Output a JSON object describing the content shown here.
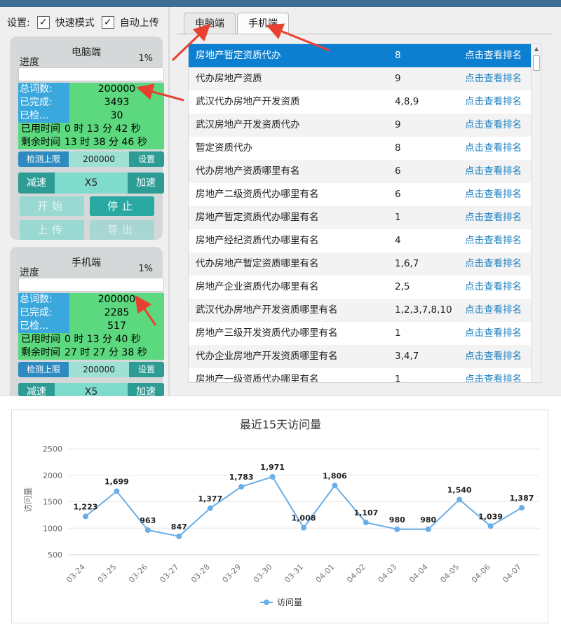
{
  "settings": {
    "label": "设置:",
    "check_mark": "✓",
    "fast_mode": "快速模式",
    "auto_upload": "自动上传"
  },
  "pc_panel": {
    "title": "电脑端",
    "progress_label": "进度",
    "progress_pct": "1%",
    "stats": [
      {
        "label": "总词数:",
        "value": "200000"
      },
      {
        "label": "已完成:",
        "value": "3493"
      },
      {
        "label": "已检...",
        "value": "30"
      }
    ],
    "time_used": {
      "label": "已用时间",
      "value": "0 时 13 分 42 秒"
    },
    "time_left": {
      "label": "剩余时间",
      "value": "13 时 38 分 46 秒"
    },
    "limit": {
      "label": "检测上限",
      "value": "200000",
      "button": "设置"
    },
    "speed": {
      "down": "减速",
      "value": "X5",
      "up": "加速"
    },
    "buttons": {
      "start": "开始",
      "stop": "停止",
      "upload": "上传",
      "export": "导出"
    }
  },
  "mobile_panel": {
    "title": "手机端",
    "progress_label": "进度",
    "progress_pct": "1%",
    "stats": [
      {
        "label": "总词数:",
        "value": "200000"
      },
      {
        "label": "已完成:",
        "value": "2285"
      },
      {
        "label": "已检...",
        "value": "517"
      }
    ],
    "time_used": {
      "label": "已用时间",
      "value": "0 时 13 分 40 秒"
    },
    "time_left": {
      "label": "剩余时间",
      "value": "27 时 27 分 38 秒"
    },
    "limit": {
      "label": "检测上限",
      "value": "200000",
      "button": "设置"
    },
    "speed": {
      "down": "减速",
      "value": "X5",
      "up": "加速"
    }
  },
  "tabs": [
    "电脑端",
    "手机端"
  ],
  "rows": [
    {
      "name": "房地产暂定资质代办",
      "rank": "8",
      "link": "点击查看排名"
    },
    {
      "name": "代办房地产资质",
      "rank": "9",
      "link": "点击查看排名"
    },
    {
      "name": "武汉代办房地产开发资质",
      "rank": "4,8,9",
      "link": "点击查看排名"
    },
    {
      "name": "武汉房地产开发资质代办",
      "rank": "9",
      "link": "点击查看排名"
    },
    {
      "name": "暂定资质代办",
      "rank": "8",
      "link": "点击查看排名"
    },
    {
      "name": "代办房地产资质哪里有名",
      "rank": "6",
      "link": "点击查看排名"
    },
    {
      "name": "房地产二级资质代办哪里有名",
      "rank": "6",
      "link": "点击查看排名"
    },
    {
      "name": "房地产暂定资质代办哪里有名",
      "rank": "1",
      "link": "点击查看排名"
    },
    {
      "name": "房地产经纪资质代办哪里有名",
      "rank": "4",
      "link": "点击查看排名"
    },
    {
      "name": "代办房地产暂定资质哪里有名",
      "rank": "1,6,7",
      "link": "点击查看排名"
    },
    {
      "name": "房地产企业资质代办哪里有名",
      "rank": "2,5",
      "link": "点击查看排名"
    },
    {
      "name": "武汉代办房地产开发资质哪里有名",
      "rank": "1,2,3,7,8,10",
      "link": "点击查看排名"
    },
    {
      "name": "房地产三级开发资质代办哪里有名",
      "rank": "1",
      "link": "点击查看排名"
    },
    {
      "name": "代办企业房地产开发资质哪里有名",
      "rank": "3,4,7",
      "link": "点击查看排名"
    },
    {
      "name": "房地产一级资质代办哪里有名",
      "rank": "1",
      "link": "点击查看排名"
    }
  ],
  "colors": {
    "accent": "#0c7fd0",
    "green": "#5cd87e",
    "blue_label": "#3aa7dd",
    "teal": "#2aa9a3",
    "arrow": "#e8412f",
    "line": "#6aaee8"
  },
  "chart_data": {
    "type": "line",
    "title": "最近15天访问量",
    "ylabel": "访问量",
    "xlabel": "",
    "categories": [
      "03-24",
      "03-25",
      "03-26",
      "03-27",
      "03-28",
      "03-29",
      "03-30",
      "03-31",
      "04-01",
      "04-02",
      "04-03",
      "04-04",
      "04-05",
      "04-06",
      "04-07"
    ],
    "series": [
      {
        "name": "访问量",
        "values": [
          1223,
          1699,
          963,
          847,
          1377,
          1783,
          1971,
          1008,
          1806,
          1107,
          980,
          980,
          1540,
          1039,
          1387
        ]
      }
    ],
    "data_labels": [
      "1,223",
      "1,699",
      "963",
      "847",
      "1,377",
      "1,783",
      "1,971",
      "1,008",
      "1,806",
      "1,107",
      "980",
      "980",
      "1,540",
      "1,039",
      "1,387"
    ],
    "ylim": [
      500,
      2500
    ],
    "yticks": [
      "500",
      "1000",
      "1500",
      "2000",
      "2500"
    ],
    "grid": true,
    "legend": "bottom"
  }
}
